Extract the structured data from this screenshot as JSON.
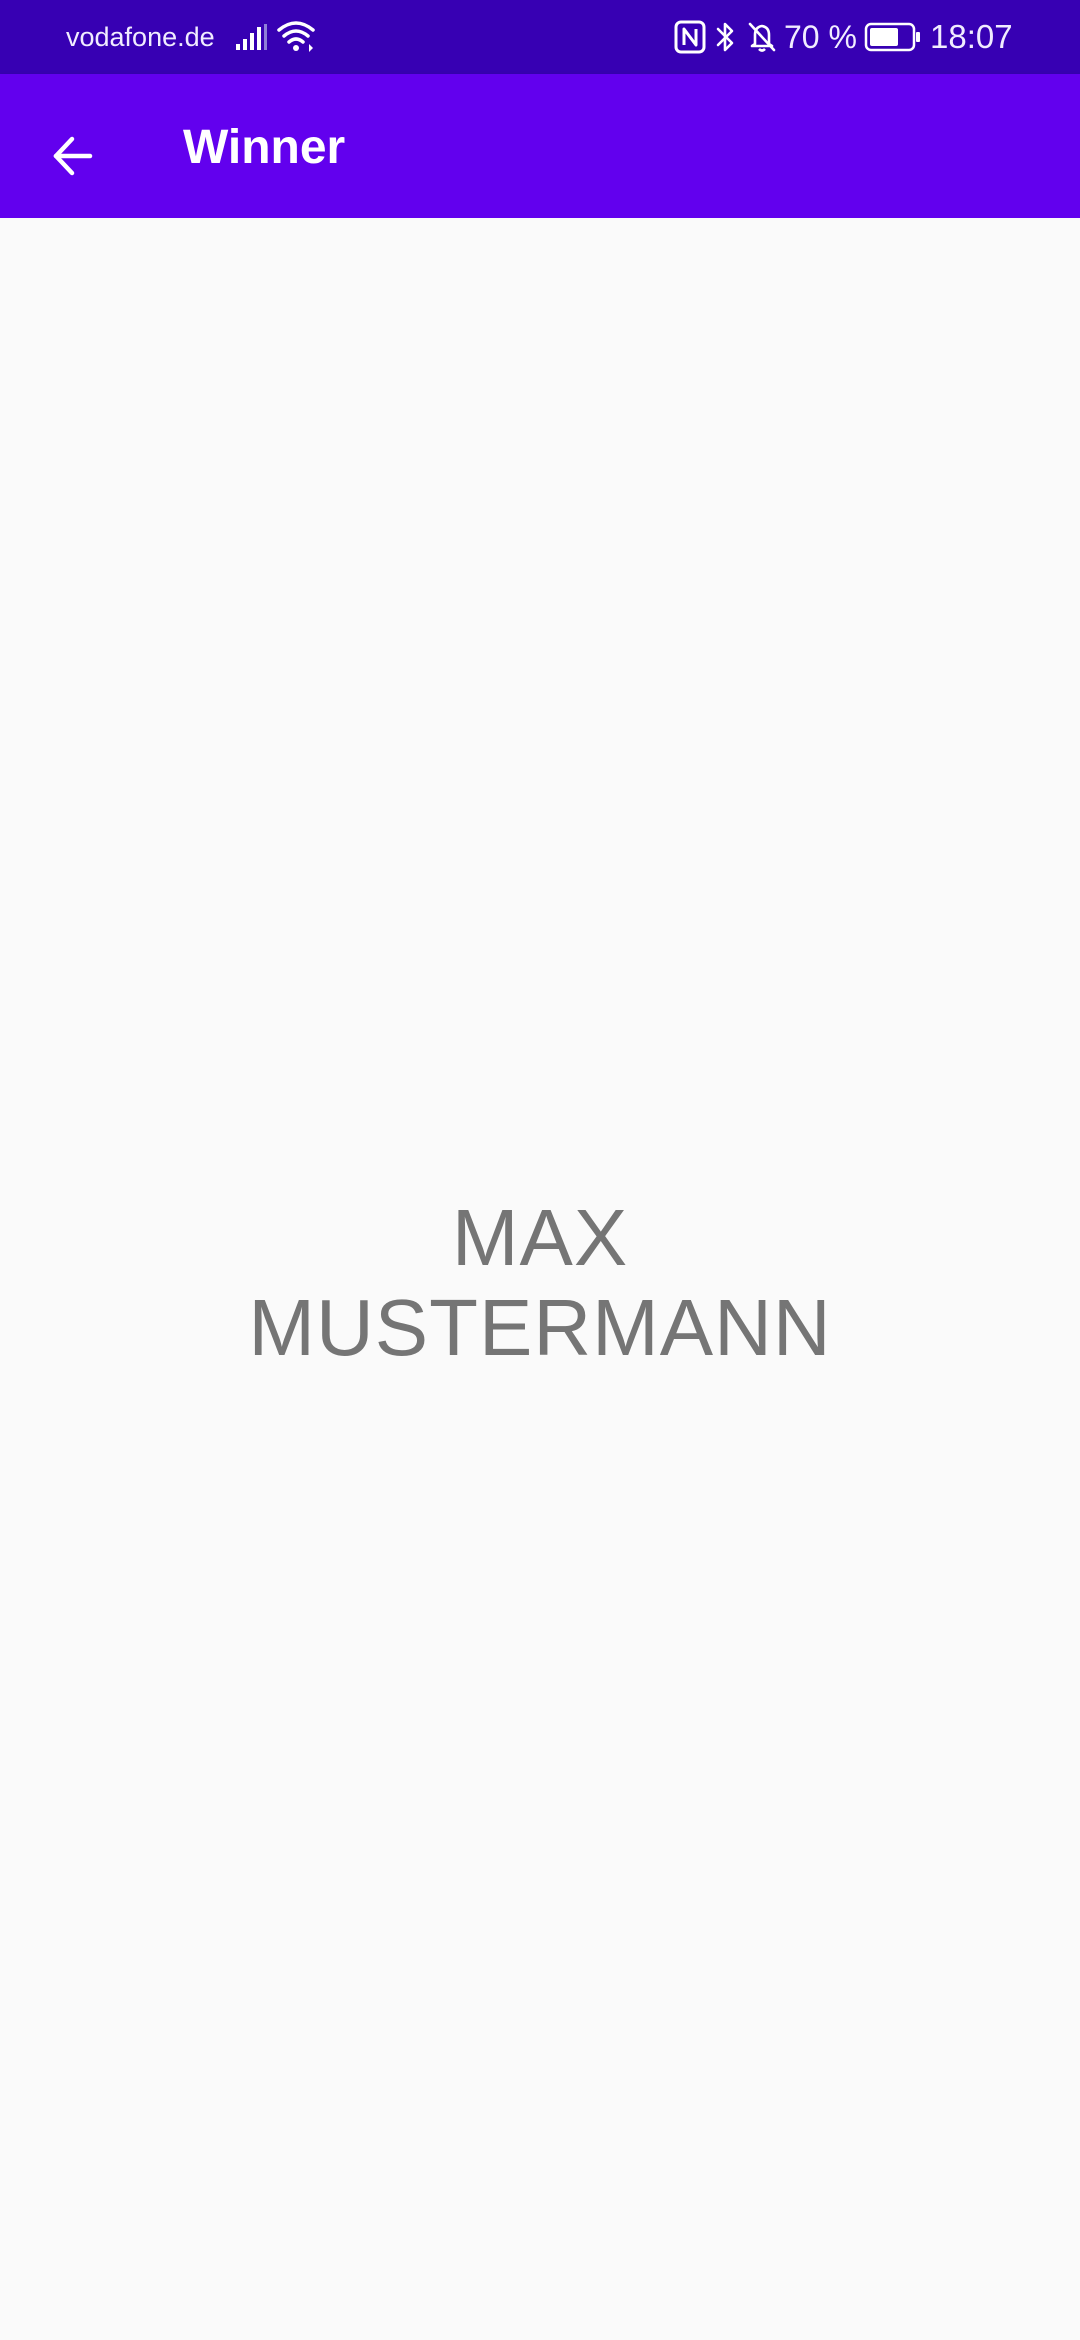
{
  "status_bar": {
    "carrier": "vodafone.de",
    "battery_percent": "70 %",
    "battery_level": 0.7,
    "time": "18:07",
    "icons": [
      "signal-icon",
      "wifi-icon",
      "nfc-icon",
      "bluetooth-icon",
      "bell-off-icon",
      "battery-icon"
    ]
  },
  "app_bar": {
    "title": "Winner",
    "back_icon": "arrow-back-icon"
  },
  "content": {
    "winner_line1": "MAX",
    "winner_line2": "MUSTERMANN"
  },
  "colors": {
    "status_bar": "#3700b3",
    "app_bar": "#6200ee",
    "background": "#fafafa",
    "winner_text": "#757575"
  }
}
